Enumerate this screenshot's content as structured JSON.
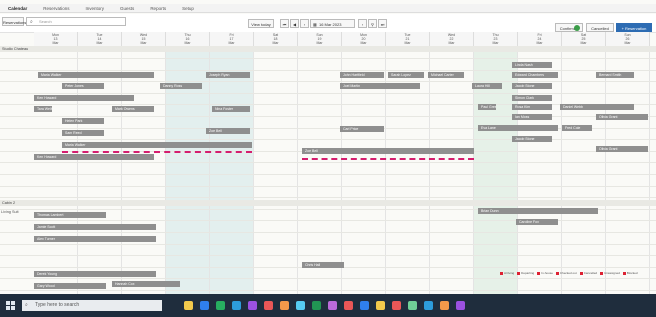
{
  "nav": {
    "tabs": [
      "Calendar",
      "Reservations",
      "Inventory",
      "Guests",
      "Reports",
      "Setup"
    ]
  },
  "toolbar": {
    "left_label": "Reservations",
    "search_placeholder": "Search",
    "today_label": "View today",
    "date_value": "16 Mar 2023",
    "tooltip": "Reservation Filters",
    "right_a": "Confirmed",
    "right_b": "Cancelled",
    "new_reservation": "+ Reservation"
  },
  "columns": [
    {
      "day": "Mon",
      "num": "13",
      "month": "Mar"
    },
    {
      "day": "Tue",
      "num": "14",
      "month": "Mar"
    },
    {
      "day": "Wed",
      "num": "15",
      "month": "Mar"
    },
    {
      "day": "Thu",
      "num": "16",
      "month": "Mar"
    },
    {
      "day": "Fri",
      "num": "17",
      "month": "Mar"
    },
    {
      "day": "Sat",
      "num": "18",
      "month": "Mar"
    },
    {
      "day": "Sun",
      "num": "19",
      "month": "Mar"
    },
    {
      "day": "Mon",
      "num": "20",
      "month": "Mar"
    },
    {
      "day": "Tue",
      "num": "21",
      "month": "Mar"
    },
    {
      "day": "Wed",
      "num": "22",
      "month": "Mar"
    },
    {
      "day": "Thu",
      "num": "23",
      "month": "Mar"
    },
    {
      "day": "Fri",
      "num": "24",
      "month": "Mar"
    },
    {
      "day": "Sat",
      "num": "25",
      "month": "Mar"
    },
    {
      "day": "Sun",
      "num": "26",
      "month": "Mar"
    }
  ],
  "sections": {
    "first": "Studio Chateau",
    "second": "Cabin 2"
  },
  "row_labels": [
    "Living Suit"
  ],
  "reservations_top": [
    "Maria Walker",
    "Joseph Ryan",
    "John Hartfield",
    "Sarah Lopez",
    "Michael Carter",
    "Edward Chambers",
    "Bernard Smith",
    "Linda Nash",
    "Peter Jones",
    "Danny Ross",
    "Joel Martin",
    "Laura Hill",
    "Jacob Stone",
    "Ken Howard",
    "Simon Clark",
    "Tara Wells",
    "Mark Owens",
    "Nina Foster",
    "Paul Green",
    "Rosa Kim",
    "Daniel Webb",
    "Helen Park",
    "Ian Moss",
    "Olivia Grant",
    "Sam Reed",
    "Zoe Bell",
    "Carl Price",
    "Eva Lane",
    "Fred Cole"
  ],
  "reservations_bottom": [
    "Thomas Lambert",
    "Jamie Scott",
    "Alex Turner",
    "Brian Dunn",
    "Caroline Fox",
    "Chris Hall",
    "Derek Young",
    "Gary Wood",
    "Hannah Cox"
  ],
  "legend": [
    "Arriving",
    "Departing",
    "In-house",
    "Checked out",
    "Cancelled",
    "Unassigned",
    "Blocked"
  ],
  "taskbar": {
    "search_placeholder": "Type here to search"
  },
  "colors": {
    "bar": "#8f8f8f",
    "weekend": "#e3efee",
    "dashed": "#d41d6e",
    "taskbar": "#1f2d3d"
  }
}
